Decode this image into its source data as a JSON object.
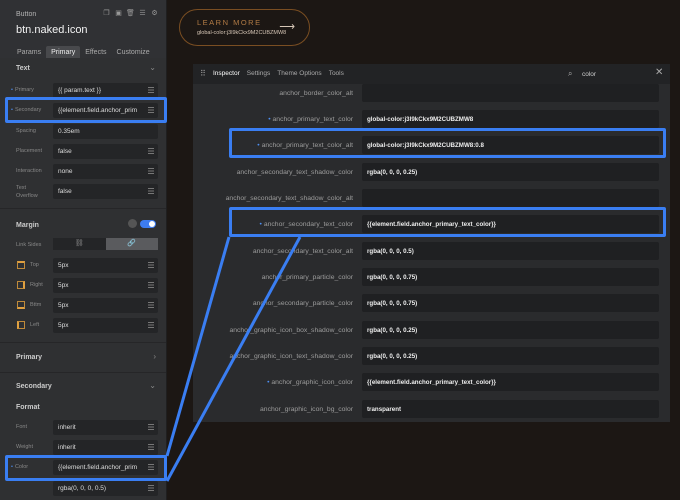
{
  "left_panel": {
    "element_type": "Button",
    "title": "btn.naked.icon",
    "header_icons": [
      "copy-icon",
      "save-icon",
      "trash-icon",
      "sliders-icon",
      "gear-icon"
    ],
    "tabs": [
      "Params",
      "Primary",
      "Effects",
      "Customize"
    ],
    "active_tab": "Primary",
    "text_section": {
      "heading": "Text",
      "rows": [
        {
          "label": "Primary",
          "value": "{{ param.text }}"
        },
        {
          "label": "Secondary",
          "value": "{{element.field.anchor_prim"
        },
        {
          "label": "Spacing",
          "value": "0.35em"
        },
        {
          "label": "Placement",
          "value": "false"
        },
        {
          "label": "Interaction",
          "value": "none"
        },
        {
          "label": "Text Overflow",
          "value": "false"
        }
      ]
    },
    "margin_section": {
      "heading": "Margin",
      "link_sides_label": "Link Sides",
      "rows": [
        {
          "label": "Top",
          "value": "5px"
        },
        {
          "label": "Right",
          "value": "5px"
        },
        {
          "label": "Bttm",
          "value": "5px"
        },
        {
          "label": "Left",
          "value": "5px"
        }
      ]
    },
    "primary_collapsed": "Primary",
    "secondary_section": {
      "heading": "Secondary",
      "format_label": "Format",
      "rows": [
        {
          "label": "Font",
          "value": "inherit"
        },
        {
          "label": "Weight",
          "value": "inherit"
        },
        {
          "label": "Color",
          "value": "{{element.field.anchor_prim"
        },
        {
          "label": "",
          "value": "rgba(0, 0, 0, 0.5)"
        }
      ]
    }
  },
  "learn_button": {
    "label": "LEARN MORE",
    "sublabel": "global-color:j3l9kCkx9M2CUBZMW8",
    "arrow": "⟶"
  },
  "inspector": {
    "tabs": [
      "Inspector",
      "Settings",
      "Theme Options",
      "Tools"
    ],
    "active_tab": "Inspector",
    "search_query": "color",
    "rows": [
      {
        "label": "anchor_border_color_alt",
        "value": "",
        "dot": false
      },
      {
        "label": "anchor_primary_text_color",
        "value": "global-color:j3l9kCkx9M2CUBZMW8",
        "dot": true
      },
      {
        "label": "anchor_primary_text_color_alt",
        "value": "global-color:j3l9kCkx9M2CUBZMW8:0.8",
        "dot": true
      },
      {
        "label": "anchor_secondary_text_shadow_color",
        "value": "rgba(0, 0, 0, 0.25)",
        "dot": false
      },
      {
        "label": "anchor_secondary_text_shadow_color_alt",
        "value": "",
        "dot": false
      },
      {
        "label": "anchor_secondary_text_color",
        "value": "{{element.field.anchor_primary_text_color}}",
        "dot": true
      },
      {
        "label": "anchor_secondary_text_color_alt",
        "value": "rgba(0, 0, 0, 0.5)",
        "dot": false
      },
      {
        "label": "anchor_primary_particle_color",
        "value": "rgba(0, 0, 0, 0.75)",
        "dot": false
      },
      {
        "label": "anchor_secondary_particle_color",
        "value": "rgba(0, 0, 0, 0.75)",
        "dot": false
      },
      {
        "label": "anchor_graphic_icon_box_shadow_color",
        "value": "rgba(0, 0, 0, 0.25)",
        "dot": false
      },
      {
        "label": "anchor_graphic_icon_text_shadow_color",
        "value": "rgba(0, 0, 0, 0.25)",
        "dot": false
      },
      {
        "label": "anchor_graphic_icon_color",
        "value": "{{element.field.anchor_primary_text_color}}",
        "dot": true
      },
      {
        "label": "anchor_graphic_icon_bg_color",
        "value": "transparent",
        "dot": false
      }
    ]
  },
  "colors": {
    "highlight": "#3a7ef2",
    "panel_bg": "#2f3032",
    "page_bg": "#1c1714",
    "accent_copper": "#b27b45"
  }
}
